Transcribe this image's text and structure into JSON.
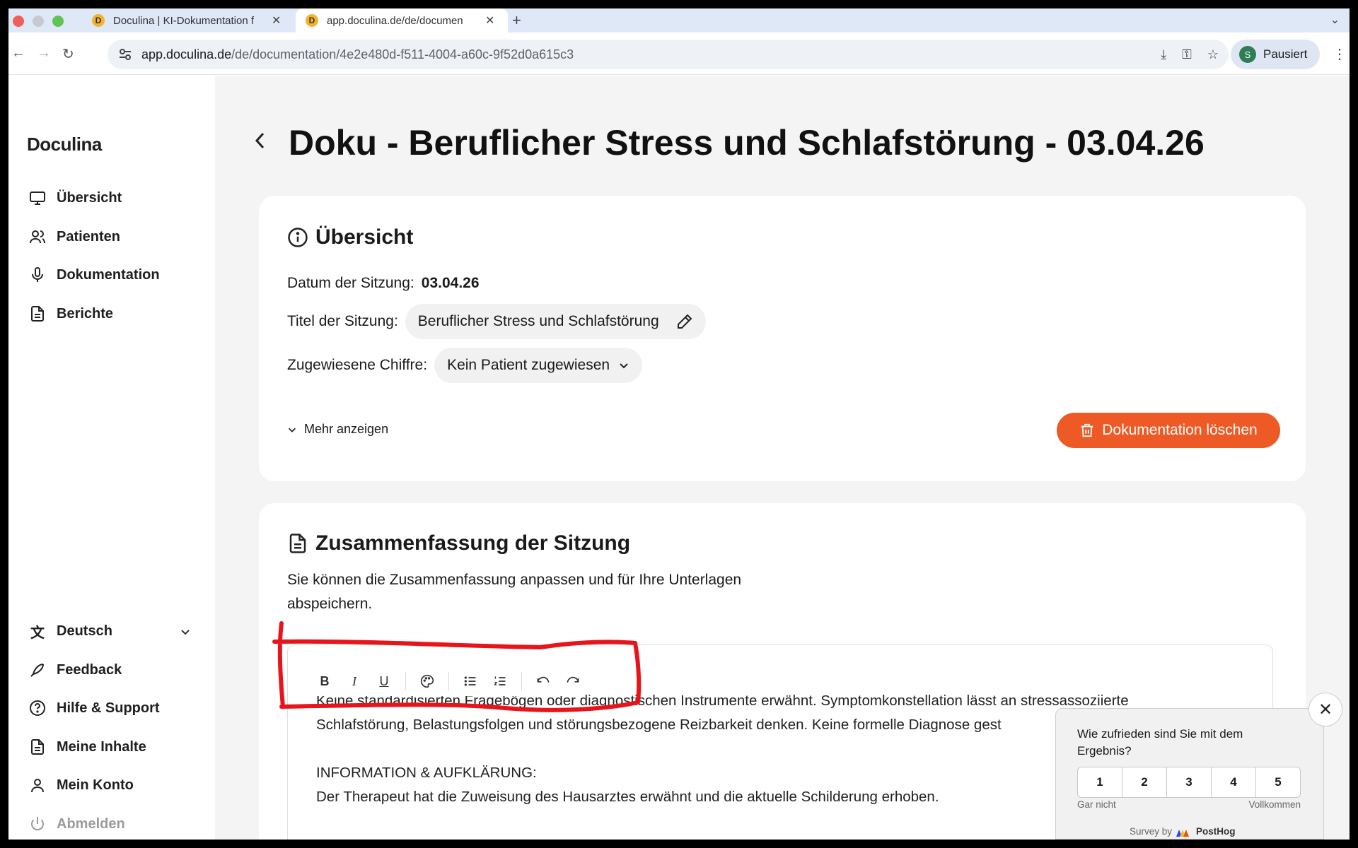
{
  "browser": {
    "tabs": [
      {
        "label": "Doculina | KI-Dokumentation f",
        "favicon": "D"
      },
      {
        "label": "app.doculina.de/de/documen",
        "favicon": "D"
      }
    ],
    "url_host": "app.doculina.de",
    "url_path": "/de/documentation/4e2e480d-f511-4004-a60c-9f52d0a615c3",
    "profile_initial": "S",
    "profile_label": "Pausiert"
  },
  "sidebar": {
    "logo": "Doculina",
    "nav": [
      {
        "label": "Übersicht",
        "icon": "monitor-icon"
      },
      {
        "label": "Patienten",
        "icon": "users-icon"
      },
      {
        "label": "Dokumentation",
        "icon": "microphone-icon"
      },
      {
        "label": "Berichte",
        "icon": "document-icon"
      }
    ],
    "bottom": [
      {
        "label": "Deutsch",
        "icon": "translate-icon"
      },
      {
        "label": "Feedback",
        "icon": "feedback-icon"
      },
      {
        "label": "Hilfe & Support",
        "icon": "help-icon"
      },
      {
        "label": "Meine Inhalte",
        "icon": "document-icon"
      },
      {
        "label": "Mein Konto",
        "icon": "user-icon"
      },
      {
        "label": "Abmelden",
        "icon": "power-icon"
      }
    ]
  },
  "page": {
    "title": "Doku - Beruflicher Stress und Schlafstörung - 03.04.26"
  },
  "overview": {
    "heading": "Übersicht",
    "date_label": "Datum der Sitzung:",
    "date_value": "03.04.26",
    "title_label": "Titel der Sitzung:",
    "title_value": "Beruflicher Stress und Schlafstörung",
    "cipher_label": "Zugewiesene Chiffre:",
    "cipher_value": "Kein Patient zugewiesen",
    "more_label": "Mehr anzeigen",
    "delete_label": "Dokumentation löschen"
  },
  "summary": {
    "heading": "Zusammenfassung der Sitzung",
    "description": "Sie können die Zusammenfassung anpassen und für Ihre Unterlagen abspeichern.",
    "lines": [
      "Keine standardisierten Fragebögen oder diagnostischen Instrumente erwähnt. Symptomkonstellation lässt an stressassoziierte",
      "Schlafstörung, Belastungsfolgen und störungsbezogene Reizbarkeit denken. Keine formelle Diagnose gest",
      "",
      "INFORMATION & AUFKLÄRUNG:",
      "Der Therapeut hat die Zuweisung des Hausarztes erwähnt und die aktuelle Schilderung erhoben."
    ]
  },
  "survey": {
    "question": "Wie zufrieden sind Sie mit dem Ergebnis?",
    "options": [
      "1",
      "2",
      "3",
      "4",
      "5"
    ],
    "low_label": "Gar nicht",
    "high_label": "Vollkommen",
    "powered_prefix": "Survey by",
    "powered_brand": "PostHog"
  },
  "colors": {
    "accent": "#ee5a26",
    "annotation": "#e8141b"
  }
}
